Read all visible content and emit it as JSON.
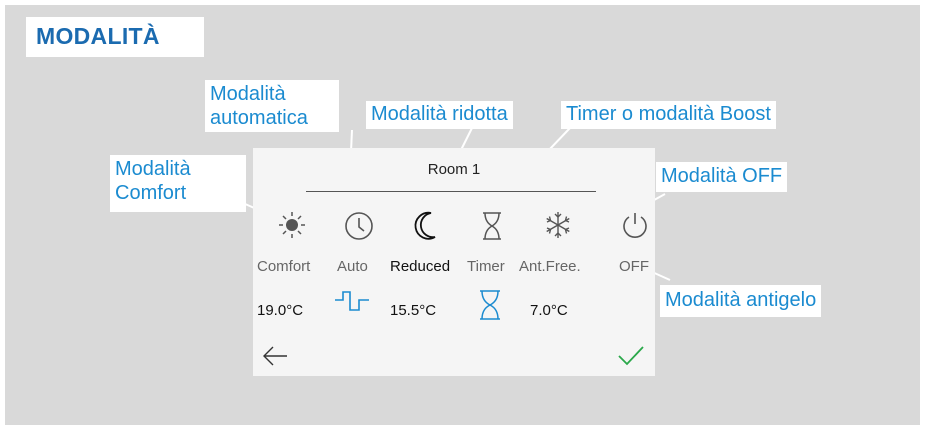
{
  "title": "MODALITÀ",
  "callouts": {
    "auto_line1": "Modalità",
    "auto_line2": "automatica",
    "reduced": "Modalità ridotta",
    "timer": "Timer o modalità Boost",
    "comfort_line1": "Modalità",
    "comfort_line2": "Comfort",
    "off": "Modalità OFF",
    "antifreeze": "Modalità antigelo"
  },
  "panel": {
    "room_name": "Room 1",
    "modes": [
      {
        "label": "Comfort",
        "icon": "sun-icon",
        "value": "19.0°C"
      },
      {
        "label": "Auto",
        "icon": "clock-icon",
        "value": ""
      },
      {
        "label": "Reduced",
        "icon": "moon-icon",
        "value": "15.5°C",
        "selected": true
      },
      {
        "label": "Timer",
        "icon": "hourglass-icon",
        "value": ""
      },
      {
        "label": "Ant.Free.",
        "icon": "snowflake-icon",
        "value": "7.0°C"
      },
      {
        "label": "OFF",
        "icon": "power-icon",
        "value": ""
      }
    ],
    "back_icon": "back-arrow-icon",
    "confirm_icon": "check-icon"
  },
  "colors": {
    "accent": "#1b6bb0",
    "callout_text": "#1b8bd0",
    "schedule_blue": "#1b8bd0",
    "confirm_green": "#2aa84a",
    "background": "#d9d9d9"
  }
}
